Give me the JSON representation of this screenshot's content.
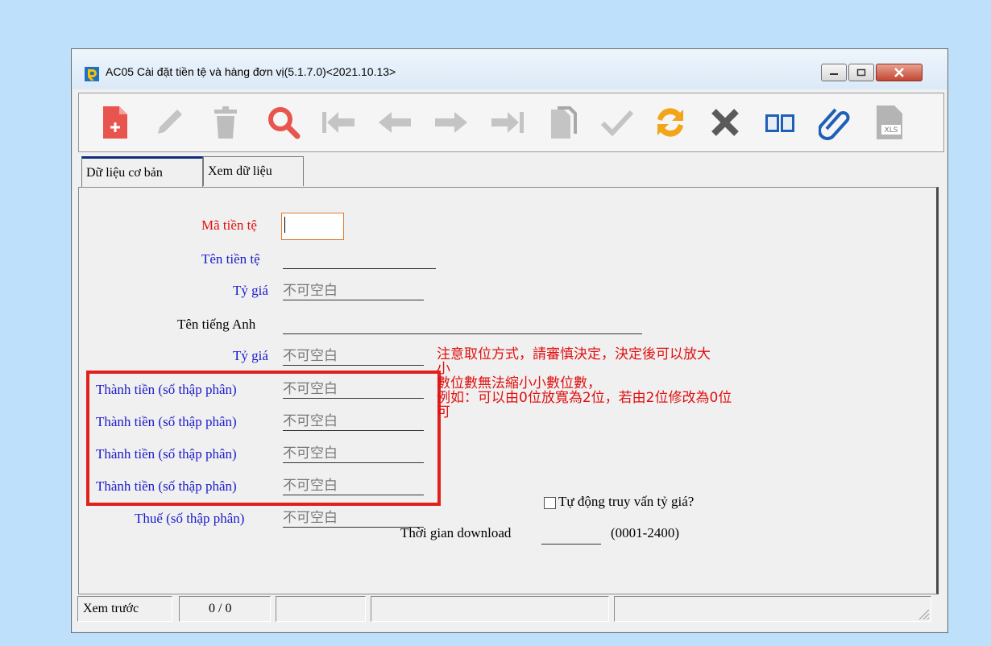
{
  "window": {
    "title": "AC05 Cài đặt tiền tệ và hàng đơn vị(5.1.7.0)<2021.10.13>"
  },
  "toolbar": {
    "buttons": [
      {
        "name": "new",
        "icon": "new-document-icon"
      },
      {
        "name": "edit",
        "icon": "pencil-icon"
      },
      {
        "name": "delete",
        "icon": "trash-icon"
      },
      {
        "name": "search",
        "icon": "search-icon"
      },
      {
        "name": "first",
        "icon": "first-record-icon"
      },
      {
        "name": "previous",
        "icon": "arrow-left-icon"
      },
      {
        "name": "next",
        "icon": "arrow-right-icon"
      },
      {
        "name": "last",
        "icon": "last-record-icon"
      },
      {
        "name": "copy",
        "icon": "copy-icon"
      },
      {
        "name": "confirm",
        "icon": "check-icon"
      },
      {
        "name": "refresh",
        "icon": "refresh-icon"
      },
      {
        "name": "cancel",
        "icon": "x-icon"
      },
      {
        "name": "manual",
        "icon": "book-icon"
      },
      {
        "name": "attach",
        "icon": "paperclip-icon"
      },
      {
        "name": "export-xls",
        "icon": "xls-icon"
      }
    ],
    "xls_label": "XLS"
  },
  "tabs": [
    "Dữ liệu cơ bản",
    "Xem dữ liệu"
  ],
  "form": {
    "currency_code_label": "Mã tiền tệ",
    "currency_name_label": "Tên tiền tệ",
    "rate_label_1": "Tỷ giá",
    "rate_placeholder_1": "不可空白",
    "english_name_label": "Tên tiếng Anh",
    "rate_label_2": "Tỷ giá",
    "rate_placeholder_2": "不可空白",
    "amount_decimal_label": "Thành tiền (số thập phân)",
    "amount_decimal_rows": [
      "不可空白",
      "不可空白",
      "不可空白",
      "不可空白"
    ],
    "tax_decimal_label": "Thuế (số thập phân)",
    "tax_decimal_placeholder": "不可空白",
    "note_lines": [
      "注意取位方式，請審慎決定，決定後可以放大",
      "小",
      "數位數無法縮小小數位數，",
      "例如：可以由0位放寬為2位，若由2位修改為0位",
      "可"
    ],
    "auto_rate_label": "Tự động truy vấn tỷ giá?",
    "download_time_label": "Thời gian download",
    "download_time_hint": "(0001-2400)"
  },
  "status": {
    "preview": "Xem trước",
    "record_count": "0 / 0"
  },
  "colors": {
    "highlight_box": "#e0201c",
    "label_blue": "#1a1acc",
    "label_red": "#e01010",
    "background": "#bfe0fb"
  }
}
